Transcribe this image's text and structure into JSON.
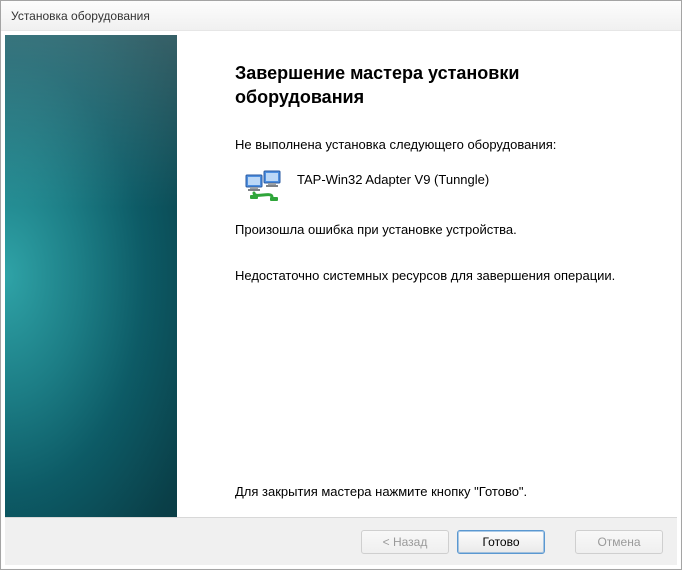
{
  "window": {
    "title": "Установка оборудования"
  },
  "content": {
    "heading": "Завершение мастера установки оборудования",
    "not_installed_msg": "Не выполнена установка следующего оборудования:",
    "device_name": "TAP-Win32 Adapter V9 (Tunngle)",
    "error_msg": "Произошла ошибка при установке устройства.",
    "detail_msg": "Недостаточно системных ресурсов для завершения операции.",
    "close_hint": "Для закрытия мастера нажмите кнопку \"Готово\"."
  },
  "buttons": {
    "back": "< Назад",
    "finish": "Готово",
    "cancel": "Отмена"
  }
}
